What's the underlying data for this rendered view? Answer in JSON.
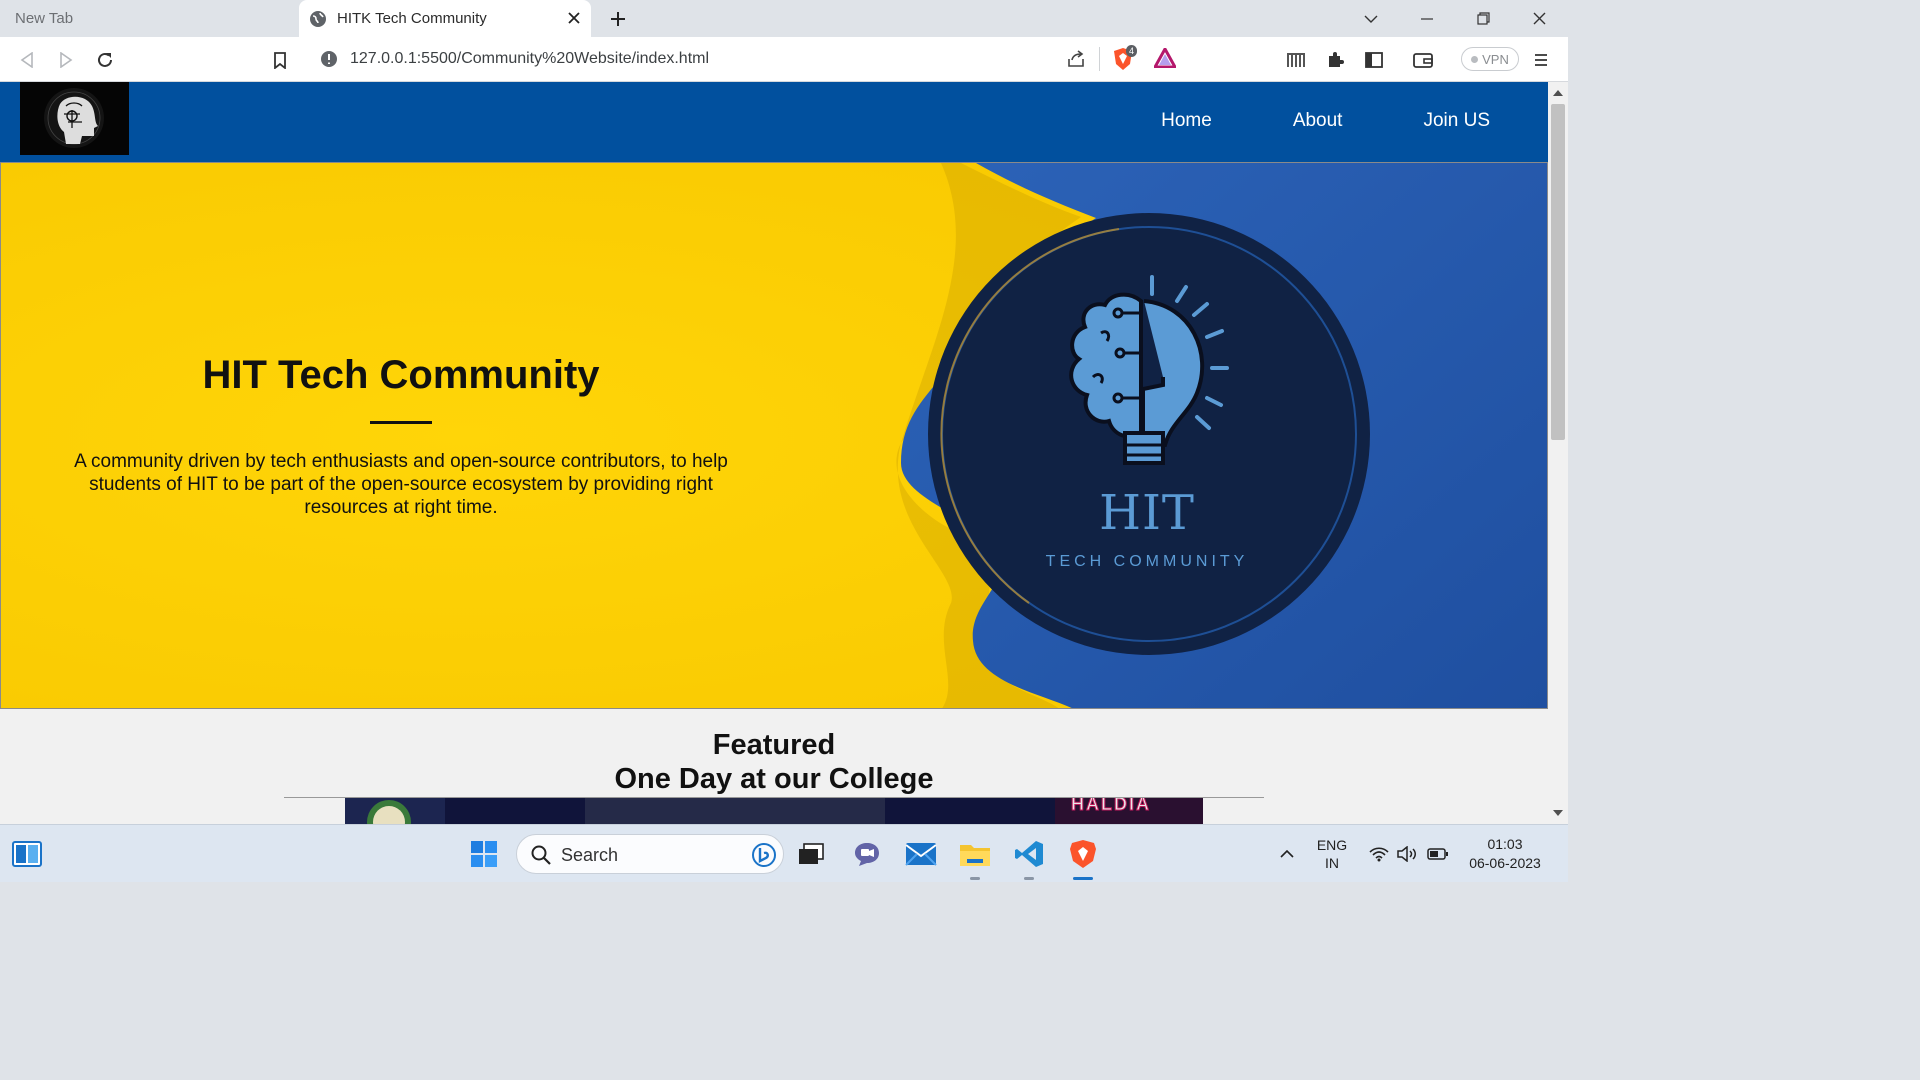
{
  "browser": {
    "tabs": [
      {
        "label": "New Tab",
        "active": false
      },
      {
        "label": "HITK Tech Community",
        "active": true
      }
    ],
    "url_host": "127.0.0.1",
    "url_rest": ":5500/Community%20Website/index.html",
    "shield_count": "4",
    "vpn_label": "VPN"
  },
  "site": {
    "nav": [
      {
        "label": "Home"
      },
      {
        "label": "About"
      },
      {
        "label": "Join US"
      }
    ],
    "hero": {
      "title": "HIT Tech Community",
      "description": "A community driven by tech enthusiasts and open-source contributors, to help students of HIT to be part of the open-source ecosystem by providing right resources at right time.",
      "badge_title": "HIT",
      "badge_subtitle": "TECH COMMUNITY"
    },
    "featured": {
      "heading": "Featured",
      "subheading": "One Day at our College",
      "image_text": "HALDIA"
    }
  },
  "taskbar": {
    "search_label": "Search",
    "lang_top": "ENG",
    "lang_bottom": "IN",
    "time": "01:03",
    "date": "06-06-2023"
  },
  "colors": {
    "nav_blue": "#01509e",
    "hero_yellow": "#ffd304",
    "paper_blue": "#2a5db0",
    "badge_navy": "#102244",
    "brain_blue": "#5b9bd5"
  }
}
